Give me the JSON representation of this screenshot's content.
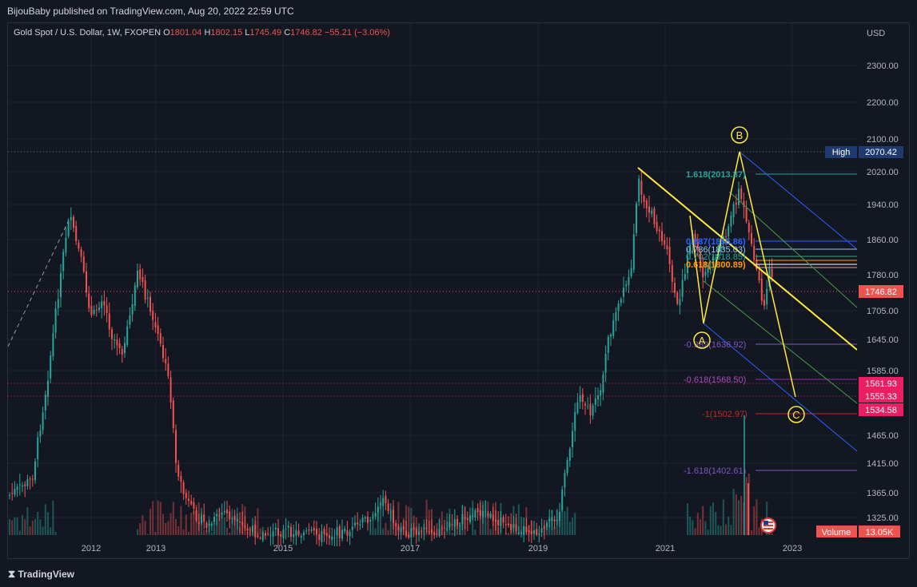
{
  "publisher": "BijouBaby published on TradingView.com, Aug 20, 2022 22:59 UTC",
  "legend": {
    "symbol": "Gold Spot / U.S. Dollar, 1W, FXOPEN",
    "o_label": "O",
    "o_value": "1801.04",
    "h_label": "H",
    "h_value": "1802.15",
    "l_label": "L",
    "l_value": "1745.49",
    "c_label": "C",
    "c_value": "1746.82",
    "change": "−55.21 (−3.06%)"
  },
  "price_axis": {
    "currency": "USD",
    "ticks": [
      "2300.00",
      "2200.00",
      "2100.00",
      "2020.00",
      "1940.00",
      "1860.00",
      "1780.00",
      "1705.00",
      "1645.00",
      "1585.00",
      "1465.00",
      "1415.00",
      "1365.00",
      "1325.00"
    ]
  },
  "time_axis": {
    "ticks": [
      "2012",
      "2013",
      "2015",
      "2017",
      "2019",
      "2021",
      "2023"
    ]
  },
  "price_labels": {
    "high_label": "High",
    "high_value": "2070.42",
    "last_price": "1746.82",
    "pink_1": "1561.93",
    "pink_2": "1555.33",
    "pink_3": "1534.58"
  },
  "volume": {
    "label": "Volume",
    "value": "13.05K"
  },
  "fib": {
    "f1618": "1.618(2013.87)",
    "f0887": "0.887(1855.86)",
    "f0786": "0.786(1835.03)",
    "f0702": "0.702(1818.85)",
    "f0618": "0.618(1800.89)",
    "fm0382": "-0.382(1636.92)",
    "fm0618": "-0.618(1568.50)",
    "fm1": "-1(1502.97)",
    "fm1618": "-1.618(1402.61)"
  },
  "waves": {
    "a": "A",
    "b": "B",
    "c": "C"
  },
  "brand": "TradingView",
  "colors": {
    "up": "#26a69a",
    "down": "#ef5350",
    "wave": "#ffeb3b",
    "bg": "#131722"
  }
}
